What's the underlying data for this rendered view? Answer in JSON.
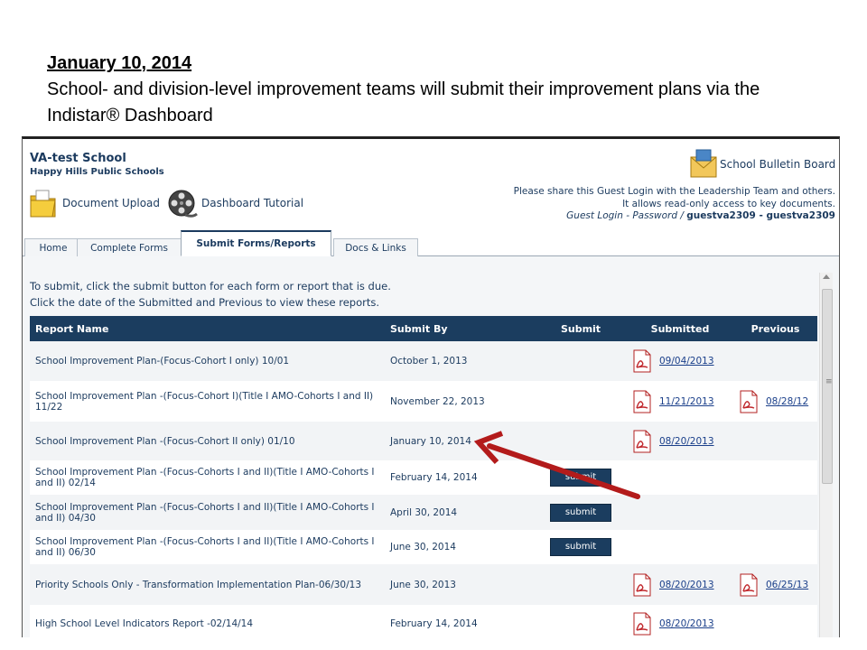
{
  "slide": {
    "date": "January 10, 2014",
    "body": "School- and division-level improvement teams will submit their improvement plans via the Indistar® Dashboard"
  },
  "header": {
    "school": "VA-test School",
    "division": "Happy Hills Public Schools",
    "document_upload": "Document Upload",
    "dashboard_tutorial": "Dashboard Tutorial",
    "bulletin_board": "School Bulletin Board",
    "guest_line1": "Please share this Guest Login with the Leadership Team and others.",
    "guest_line2": "It allows read-only access to key documents.",
    "guest_label": "Guest Login - Password /",
    "guest_credentials": "guestva2309 - guestva2309"
  },
  "tabs": [
    {
      "label": "Home"
    },
    {
      "label": "Complete Forms"
    },
    {
      "label": "Submit Forms/Reports"
    },
    {
      "label": "Docs & Links"
    }
  ],
  "instructions": {
    "line1": "To submit, click the submit button for each form or report that is due.",
    "line2": "Click the date of the Submitted and Previous to view these reports."
  },
  "table": {
    "headers": [
      "Report Name",
      "Submit By",
      "Submit",
      "Submitted",
      "Previous"
    ],
    "rows": [
      {
        "name": "School Improvement Plan-(Focus-Cohort I only) 10/01",
        "submit_by": "October 1, 2013",
        "submit": "",
        "submitted": "09/04/2013",
        "previous": ""
      },
      {
        "name": "School Improvement Plan -(Focus-Cohort I)(Title I AMO-Cohorts I and II) 11/22",
        "submit_by": "November 22, 2013",
        "submit": "",
        "submitted": "11/21/2013",
        "previous": "08/28/12"
      },
      {
        "name": "School Improvement Plan -(Focus-Cohort II only) 01/10",
        "submit_by": "January 10, 2014",
        "submit": "",
        "submitted": "08/20/2013",
        "previous": ""
      },
      {
        "name": "School Improvement Plan -(Focus-Cohorts I and II)(Title I AMO-Cohorts I and II) 02/14",
        "submit_by": "February 14, 2014",
        "submit": "submit",
        "submitted": "",
        "previous": ""
      },
      {
        "name": "School Improvement Plan -(Focus-Cohorts I and II)(Title I AMO-Cohorts I and II) 04/30",
        "submit_by": "April 30, 2014",
        "submit": "submit",
        "submitted": "",
        "previous": ""
      },
      {
        "name": "School Improvement Plan -(Focus-Cohorts I and II)(Title I AMO-Cohorts I and II) 06/30",
        "submit_by": "June 30, 2014",
        "submit": "submit",
        "submitted": "",
        "previous": ""
      },
      {
        "name": "Priority Schools Only - Transformation Implementation Plan-06/30/13",
        "submit_by": "June 30, 2013",
        "submit": "",
        "submitted": "08/20/2013",
        "previous": "06/25/13"
      },
      {
        "name": "High School Level Indicators Report -02/14/14",
        "submit_by": "February 14, 2014",
        "submit": "",
        "submitted": "08/20/2013",
        "previous": ""
      }
    ]
  },
  "colors": {
    "header_bar": "#1b3d5f",
    "link": "#1a3f8a",
    "arrow": "#b31b1b"
  }
}
